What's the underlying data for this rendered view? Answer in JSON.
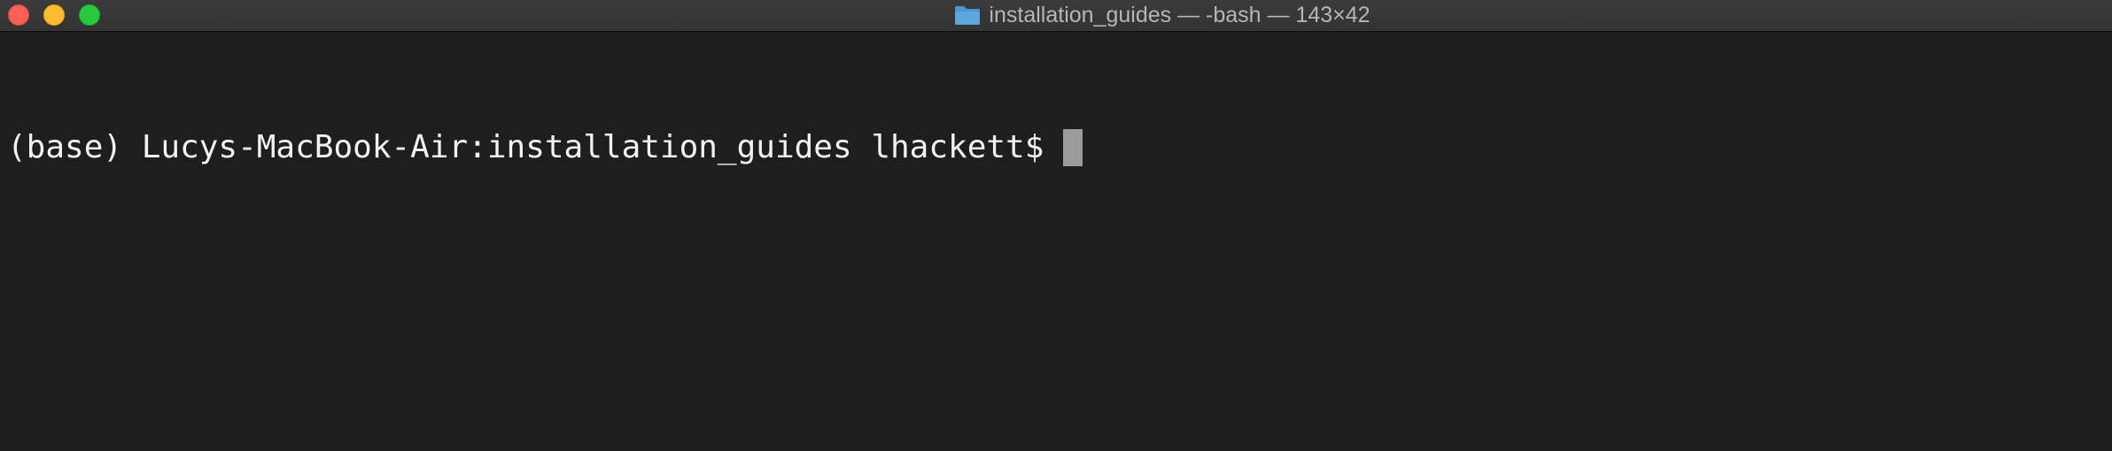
{
  "window": {
    "title": "installation_guides — -bash — 143×42"
  },
  "titlebar": {
    "folder_icon": "folder-icon",
    "folder_color": "#5aa8de"
  },
  "colors": {
    "terminal_background": "#1e1e1e",
    "terminal_text": "#f2f2f2",
    "cursor": "#9b9b9b",
    "close": "#fe5f57",
    "minimize": "#febc2e",
    "zoom": "#28c840"
  },
  "terminal": {
    "prompt": "(base) Lucys-MacBook-Air:installation_guides lhackett$"
  }
}
